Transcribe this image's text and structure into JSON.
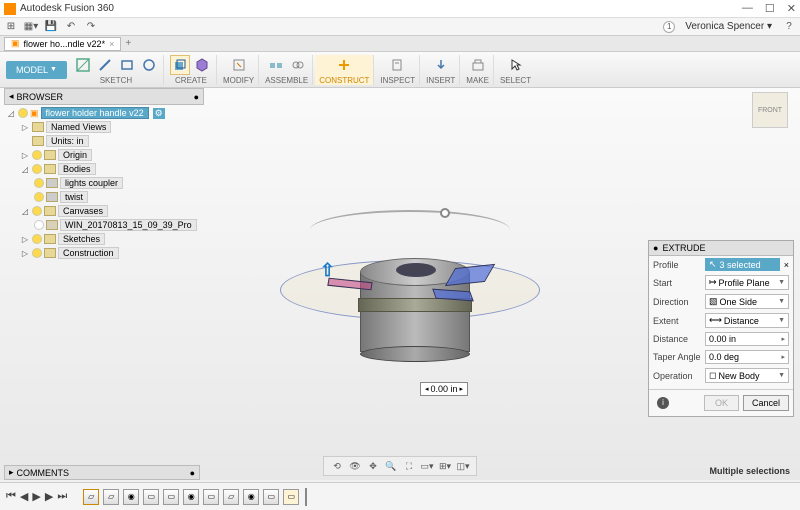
{
  "app": {
    "title": "Autodesk Fusion 360"
  },
  "window": {
    "help_badge": "1",
    "user": "Veronica Spencer"
  },
  "doctab": {
    "name": "flower ho...ndle v22*"
  },
  "workspace": {
    "label": "MODEL"
  },
  "toolbar": {
    "groups": [
      {
        "label": "SKETCH"
      },
      {
        "label": "CREATE"
      },
      {
        "label": "MODIFY"
      },
      {
        "label": "ASSEMBLE"
      },
      {
        "label": "CONSTRUCT"
      },
      {
        "label": "INSPECT"
      },
      {
        "label": "INSERT"
      },
      {
        "label": "MAKE"
      },
      {
        "label": "SELECT"
      }
    ]
  },
  "browser": {
    "title": "BROWSER",
    "root": "flower holder handle v22",
    "items": [
      {
        "label": "Named Views",
        "indent": 1,
        "arrow": "▷"
      },
      {
        "label": "Units: in",
        "indent": 1,
        "arrow": ""
      },
      {
        "label": "Origin",
        "indent": 1,
        "arrow": "▷"
      },
      {
        "label": "Bodies",
        "indent": 1,
        "arrow": "◿"
      },
      {
        "label": "lights coupler",
        "indent": 2,
        "arrow": ""
      },
      {
        "label": "twist",
        "indent": 2,
        "arrow": ""
      },
      {
        "label": "Canvases",
        "indent": 1,
        "arrow": "◿"
      },
      {
        "label": "WIN_20170813_15_09_39_Pro",
        "indent": 2,
        "arrow": ""
      },
      {
        "label": "Sketches",
        "indent": 1,
        "arrow": "▷"
      },
      {
        "label": "Construction",
        "indent": 1,
        "arrow": "▷"
      }
    ]
  },
  "viewcube": {
    "face": "FRONT"
  },
  "dimension": {
    "value": "0.00 in"
  },
  "extrude": {
    "title": "EXTRUDE",
    "profile_label": "Profile",
    "profile_value": "3 selected",
    "start_label": "Start",
    "start_value": "Profile Plane",
    "direction_label": "Direction",
    "direction_value": "One Side",
    "extent_label": "Extent",
    "extent_value": "Distance",
    "distance_label": "Distance",
    "distance_value": "0.00 in",
    "taper_label": "Taper Angle",
    "taper_value": "0.0 deg",
    "operation_label": "Operation",
    "operation_value": "New Body",
    "ok": "OK",
    "cancel": "Cancel"
  },
  "comments": {
    "title": "COMMENTS"
  },
  "status": {
    "selection": "Multiple selections"
  }
}
